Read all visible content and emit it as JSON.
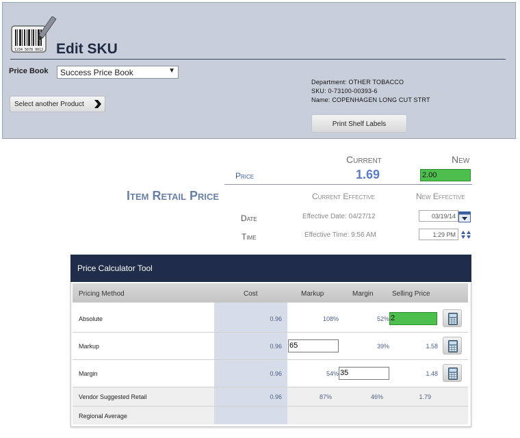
{
  "header": {
    "title": "Edit SKU",
    "price_book_label": "Price Book",
    "price_book_value": "Success Price Book",
    "select_product_label": "Select another Product",
    "department": "Department: OTHER TOBACCO",
    "sku": "SKU: 0-73100-00393-6",
    "name": "Name: COPENHAGEN LONG CUT STRT",
    "print_labels": "Print Shelf Labels",
    "barcode_digits": "1234 5678 9012"
  },
  "price": {
    "current_header": "Current",
    "new_header": "New",
    "label": "Price",
    "current_value": "1.69",
    "new_value": "2.00",
    "section_title": "Item Retail Price",
    "current_effective": "Current Effective",
    "new_effective": "New Effective",
    "date_label": "Date",
    "time_label": "Time",
    "effective_date": "Effective Date: 04/27/12",
    "effective_time": "Effective Time: 9:56 AM",
    "new_date": "03/19/14",
    "new_time": "1:29 PM"
  },
  "calculator": {
    "title": "Price Calculator Tool",
    "columns": [
      "Pricing Method",
      "Cost",
      "Markup",
      "Margin",
      "Selling Price"
    ],
    "rows": [
      {
        "method": "Absolute",
        "cost": "0.96",
        "markup": "108%",
        "margin": "52%",
        "selling": "2"
      },
      {
        "method": "Markup",
        "cost": "0.96",
        "markup": "65",
        "margin": "39%",
        "selling": "1.58"
      },
      {
        "method": "Margin",
        "cost": "0.96",
        "markup": "54%",
        "margin": "35",
        "selling": "1.48"
      },
      {
        "method": "Vendor Suggested Retail",
        "cost": "0.96",
        "markup": "87%",
        "margin": "46%",
        "selling": "1.79"
      },
      {
        "method": "Regional Average",
        "cost": "",
        "markup": "",
        "margin": "",
        "selling": ""
      }
    ]
  },
  "colors": {
    "accent_green": "#4cbf4c",
    "calc_header": "#1f2d4a",
    "header_panel": "#c8ceda",
    "link_blue": "#5b7cc4"
  }
}
